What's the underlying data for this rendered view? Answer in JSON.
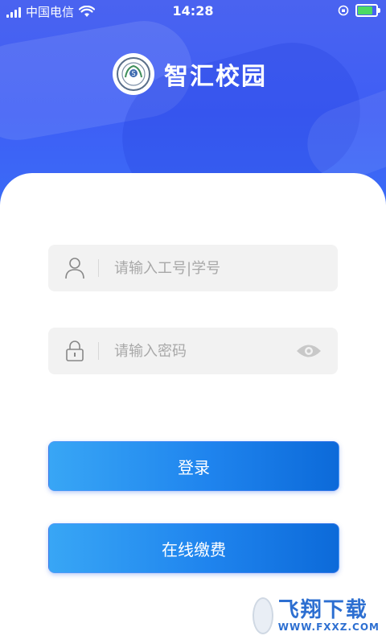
{
  "status_bar": {
    "carrier": "中国电信",
    "time": "14:28"
  },
  "header": {
    "app_title": "智汇校园"
  },
  "login_form": {
    "username_placeholder": "请输入工号|学号",
    "password_placeholder": "请输入密码"
  },
  "buttons": {
    "login_label": "登录",
    "pay_label": "在线缴费"
  },
  "watermark": {
    "brand": "飞翔下载",
    "url": "WWW.FXXZ.COM"
  },
  "colors": {
    "header_blue": "#3e5ef5",
    "button_start": "#38a6f5",
    "button_end": "#0c6ad9",
    "field_bg": "#f2f2f2"
  },
  "icons": {
    "user": "user-icon",
    "lock": "lock-icon",
    "eye": "eye-icon"
  }
}
